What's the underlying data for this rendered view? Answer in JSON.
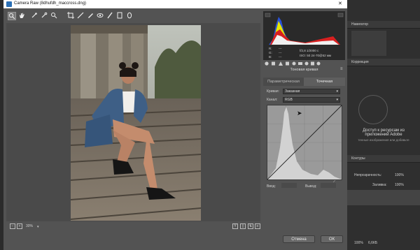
{
  "window": {
    "title": "Camera Raw (8dhufdh_maccross.dng)",
    "close": "✕"
  },
  "toolbar": {
    "tools": [
      {
        "name": "zoom-tool",
        "glyph": "🔍"
      },
      {
        "name": "hand-tool",
        "glyph": "✋"
      },
      {
        "name": "white-balance-tool",
        "glyph": "⟋"
      },
      {
        "name": "color-sampler-tool",
        "glyph": "⟋"
      },
      {
        "name": "targeted-adjustment-tool",
        "glyph": "⊕"
      },
      {
        "name": "crop-tool",
        "glyph": "⌗"
      },
      {
        "name": "straighten-tool",
        "glyph": "⟍"
      },
      {
        "name": "spot-removal-tool",
        "glyph": "✎"
      },
      {
        "name": "red-eye-tool",
        "glyph": "◎"
      },
      {
        "name": "adjustment-brush",
        "glyph": "/"
      },
      {
        "name": "graduated-filter",
        "glyph": "▭"
      },
      {
        "name": "radial-filter",
        "glyph": "◯"
      },
      {
        "name": "preferences",
        "glyph": "≡"
      },
      {
        "name": "rotate-left",
        "glyph": "↺"
      },
      {
        "name": "rotate-right",
        "glyph": "↻"
      }
    ],
    "fullscreen": "⤢"
  },
  "rgb": {
    "r_label": "R:",
    "g_label": "G:",
    "b_label": "B:",
    "r": "---",
    "g": "---",
    "b": "---",
    "line1": "f/2,8   1/2000 с",
    "line2": "ISO: 50   24-70@52 мм"
  },
  "panel": {
    "section_title": "Тоновая кривая",
    "tab_parametric": "Параметрическая",
    "tab_point": "Точечная",
    "curve_label": "Кривая:",
    "curve_value": "Заказная",
    "channel_label": "Канал:",
    "channel_value": "RGB",
    "input_label": "Ввод:",
    "output_label": "Вывод:"
  },
  "bottom": {
    "zoom": "30%"
  },
  "buttons": {
    "cancel": "Отмена",
    "ok": "ОК"
  },
  "bg_panel": {
    "navigator": "Навигатор",
    "corrections": "Коррекция",
    "library_line1": "Доступ к ресурсам из",
    "library_line2": "приложений Adobe",
    "library_line3": "тенные изображения или добавьте",
    "contours": "Контуры",
    "opacity_label": "Непрозрачность:",
    "opacity_value": "100%",
    "fill_label": "Заливка:",
    "fill_value": "100%",
    "percent": "100%",
    "size": "6,6КБ"
  }
}
